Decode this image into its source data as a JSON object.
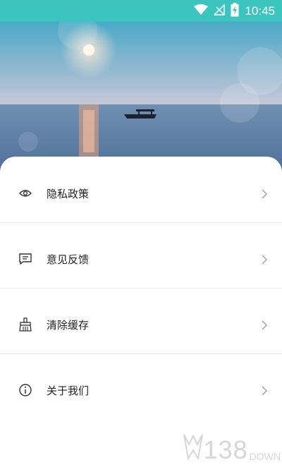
{
  "status_bar": {
    "time": "10:45",
    "icons": [
      "wifi-icon",
      "signal-off-icon",
      "battery-charging-icon"
    ],
    "background": "#3cc4be"
  },
  "hero": {
    "image": "sunset-lake-boat-photo"
  },
  "menu": {
    "items": [
      {
        "label": "隐私政策",
        "icon": "eye-icon"
      },
      {
        "label": "意见反馈",
        "icon": "feedback-icon"
      },
      {
        "label": "清除缓存",
        "icon": "brush-icon"
      },
      {
        "label": "关于我们",
        "icon": "info-icon"
      }
    ],
    "chevron_icon": "chevron-right-icon"
  },
  "watermark": {
    "number": "138",
    "suffix": "DOWN"
  }
}
